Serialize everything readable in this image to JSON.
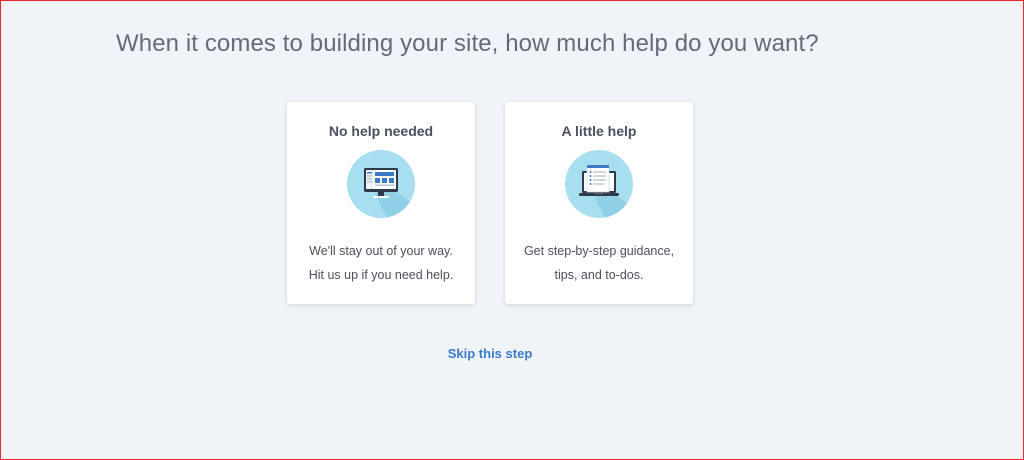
{
  "heading": "When it comes to building your site, how much help do you want?",
  "options": [
    {
      "title": "No help needed",
      "icon": "desktop-monitor-icon",
      "description_line1": "We'll stay out of your way.",
      "description_line2": "Hit us up if you need help."
    },
    {
      "title": "A little help",
      "icon": "laptop-checklist-icon",
      "description_line1": "Get step-by-step guidance,",
      "description_line2": "tips, and to-dos."
    }
  ],
  "skip_label": "Skip this step",
  "colors": {
    "background": "#f0f3f7",
    "icon_circle": "#a8dff0",
    "link": "#3a7bc8"
  }
}
